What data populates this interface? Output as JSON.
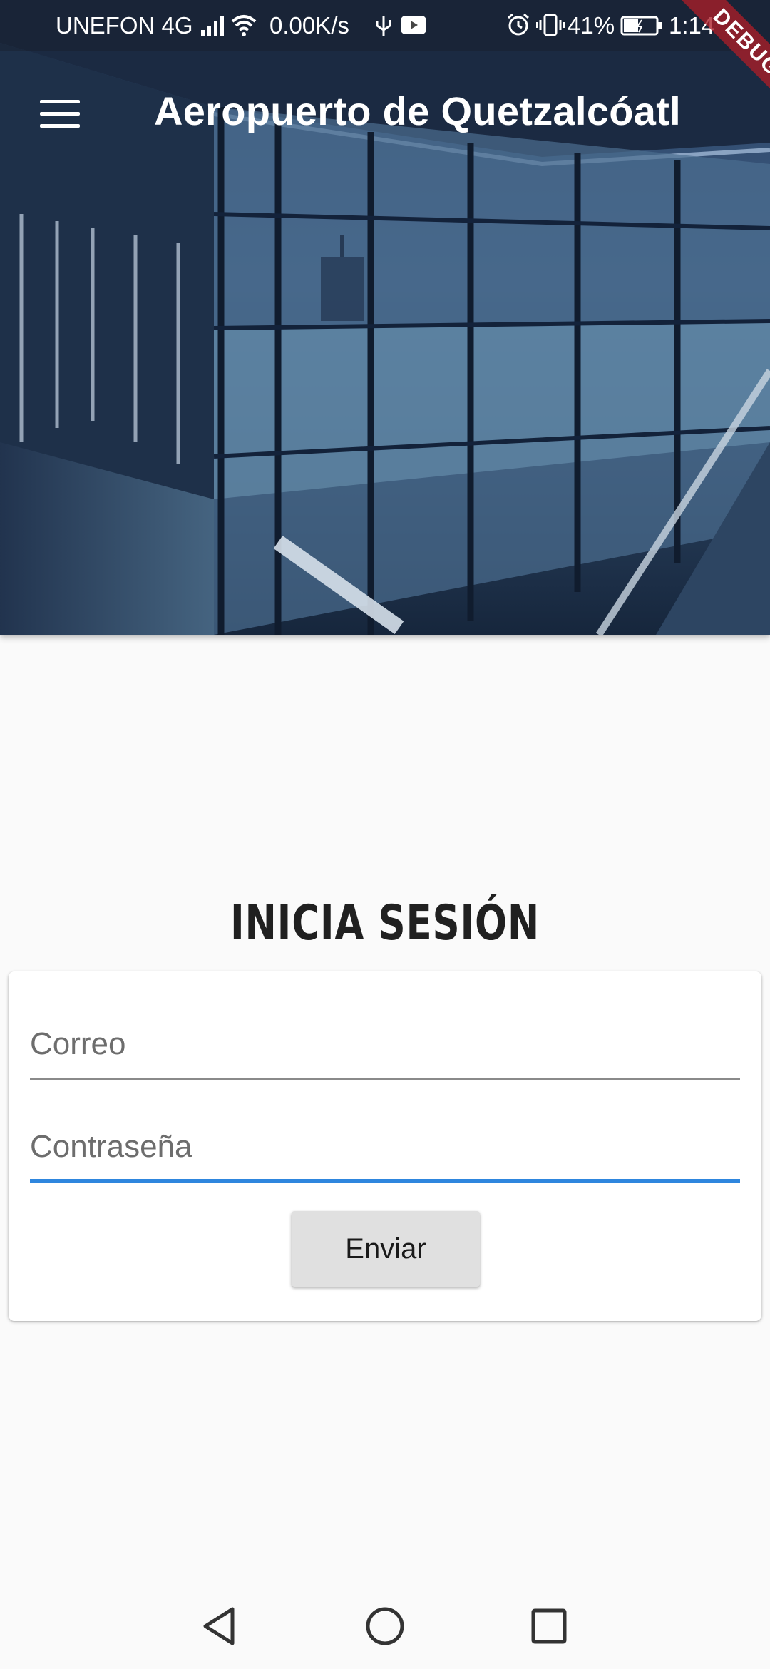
{
  "status_bar": {
    "carrier": "UNEFON 4G",
    "speed": "0.00K/s",
    "battery": "41%",
    "time": "1:14"
  },
  "app_bar": {
    "title": "Aeropuerto de Quetzalcóatl"
  },
  "debug_banner": "DEBUG",
  "login": {
    "heading": "INICIA SESIÓN",
    "email_hint": "Correo",
    "password_hint": "Contraseña",
    "submit_label": "Enviar"
  },
  "colors": {
    "focus_underline": "#2e86de",
    "background": "#fafafa"
  }
}
